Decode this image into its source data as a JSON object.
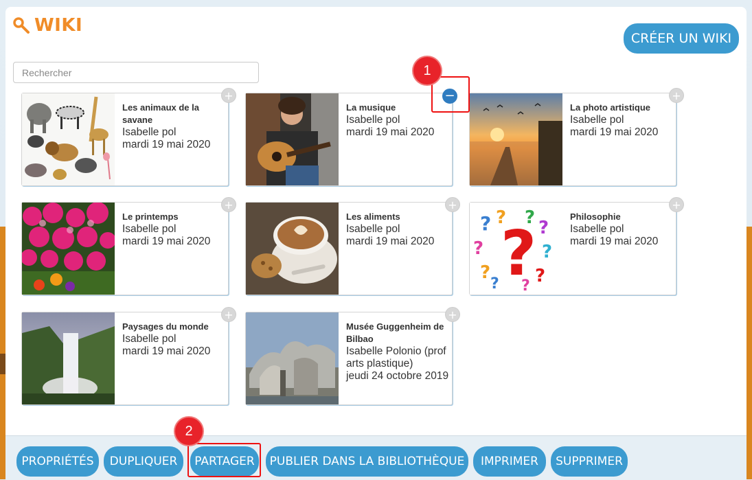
{
  "header": {
    "title": "WIKI",
    "create_label": "CRÉER UN WIKI"
  },
  "search": {
    "placeholder": "Rechercher"
  },
  "cards": [
    {
      "title": "Les animaux de la savane",
      "author": "Isabelle pol",
      "date": "mardi 19 mai 2020",
      "selected": false
    },
    {
      "title": "La musique",
      "author": "Isabelle pol",
      "date": "mardi 19 mai 2020",
      "selected": true
    },
    {
      "title": "La photo artistique",
      "author": "Isabelle pol",
      "date": "mardi 19 mai 2020",
      "selected": false
    },
    {
      "title": "Le printemps",
      "author": "Isabelle pol",
      "date": "mardi 19 mai 2020",
      "selected": false
    },
    {
      "title": "Les aliments",
      "author": "Isabelle pol",
      "date": "mardi 19 mai 2020",
      "selected": false
    },
    {
      "title": "Philosophie",
      "author": "Isabelle pol",
      "date": "mardi 19 mai 2020",
      "selected": false
    },
    {
      "title": "Paysages du monde",
      "author": "Isabelle pol",
      "date": "mardi 19 mai 2020",
      "selected": false
    },
    {
      "title": "Musée Guggenheim de Bilbao",
      "author": "Isabelle Polonio (prof arts plastique)",
      "date": "jeudi 24 octobre 2019",
      "selected": false
    }
  ],
  "select_symbol": "+",
  "deselect_symbol": "−",
  "annotations": {
    "marker1": "1",
    "marker2": "2"
  },
  "toolbar": {
    "proprietes": "PROPRIÉTÉS",
    "dupliquer": "DUPLIQUER",
    "partager": "PARTAGER",
    "publier": "PUBLIER DANS LA BIBLIOTHÈQUE",
    "imprimer": "IMPRIMER",
    "supprimer": "SUPPRIMER"
  },
  "colors": {
    "accent": "#3c9bd0",
    "title": "#f08c28",
    "highlight": "#e8232a"
  }
}
